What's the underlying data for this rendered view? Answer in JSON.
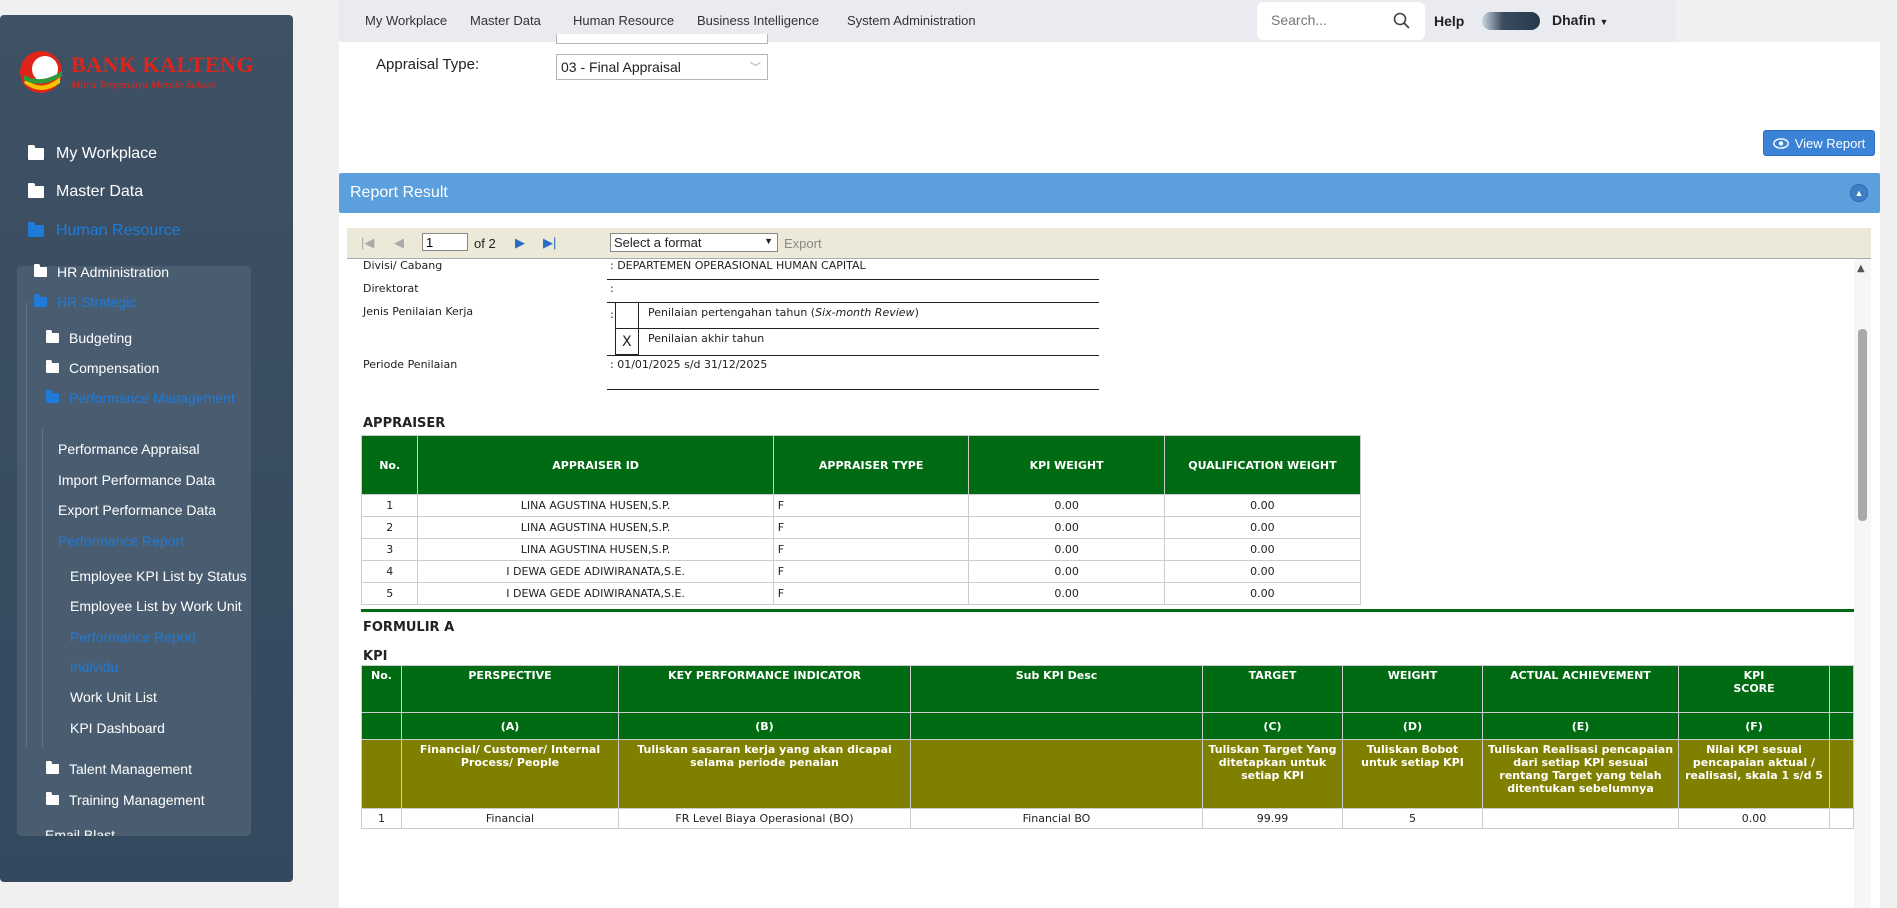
{
  "logo": {
    "title": "BANK KALTENG",
    "subtitle": "Mitra Terpercaya Meraih Sukses"
  },
  "sidebar": {
    "top": [
      {
        "label": "My Workplace"
      },
      {
        "label": "Master Data"
      },
      {
        "label": "Human Resource"
      }
    ],
    "hr": [
      {
        "label": "HR Administration"
      },
      {
        "label": "HR Strategic"
      },
      {
        "label": "Budgeting"
      },
      {
        "label": "Compensation"
      },
      {
        "label": "Performance Management"
      },
      {
        "label": "Performance Appraisal"
      },
      {
        "label": "Import Performance Data"
      },
      {
        "label": "Export Performance Data"
      },
      {
        "label": "Performance Report"
      },
      {
        "label": "Employee KPI List by Status"
      },
      {
        "label": "Employee List by Work Unit"
      },
      {
        "label": "Performance Report"
      },
      {
        "label": "Individu"
      },
      {
        "label": "Work Unit List"
      },
      {
        "label": "KPI Dashboard"
      },
      {
        "label": "Talent Management"
      },
      {
        "label": "Training Management"
      },
      {
        "label": "Email Blast"
      }
    ]
  },
  "topnav": {
    "menus": [
      "My Workplace",
      "Master Data",
      "Human Resource",
      "Business Intelligence",
      "System Administration"
    ],
    "search_placeholder": "Search...",
    "help": "Help",
    "user": "Dhafin"
  },
  "form": {
    "appraisal_type_label": "Appraisal Type:",
    "appraisal_type_value": "03 - Final Appraisal",
    "view_report": "View Report"
  },
  "result": {
    "title": "Report Result",
    "page": "1",
    "of_pages": "of 2",
    "format_placeholder": "Select a format",
    "export": "Export"
  },
  "report": {
    "info": [
      {
        "label": "Divisi/ Cabang",
        "value": ":  DEPARTEMEN OPERASIONAL HUMAN CAPITAL"
      },
      {
        "label": "Direktorat",
        "value": ":"
      },
      {
        "label": "Jenis Penilaian Kerja",
        "value": ":"
      },
      {
        "label": "Periode Penilaian",
        "value": ": 01/01/2025 s/d 31/12/2025"
      }
    ],
    "review_options": [
      {
        "mark": "",
        "text": "Penilaian pertengahan tahun (",
        "italic": "Six-month Review",
        "close": ")"
      },
      {
        "mark": "X",
        "text": "Penilaian akhir tahun"
      }
    ],
    "appraiser_title": "APPRAISER",
    "appraiser_headers": [
      "No.",
      "APPRAISER ID",
      "APPRAISER TYPE",
      "KPI WEIGHT",
      "QUALIFICATION WEIGHT"
    ],
    "appraisers": [
      [
        "1",
        "LINA AGUSTINA HUSEN,S.P.",
        "F",
        "0.00",
        "0.00"
      ],
      [
        "2",
        "LINA AGUSTINA HUSEN,S.P.",
        "F",
        "0.00",
        "0.00"
      ],
      [
        "3",
        "LINA AGUSTINA HUSEN,S.P.",
        "F",
        "0.00",
        "0.00"
      ],
      [
        "4",
        "I DEWA GEDE ADIWIRANATA,S.E.",
        "F",
        "0.00",
        "0.00"
      ],
      [
        "5",
        "I DEWA GEDE ADIWIRANATA,S.E.",
        "F",
        "0.00",
        "0.00"
      ]
    ],
    "formulir_title": "FORMULIR A",
    "kpi_title": "KPI",
    "kpi_headers": [
      "No.",
      "PERSPECTIVE",
      "KEY PERFORMANCE INDICATOR",
      "Sub KPI  Desc",
      "TARGET",
      "WEIGHT",
      "ACTUAL ACHIEVEMENT",
      "KPI\nSCORE",
      ""
    ],
    "kpi_letters": [
      "",
      "(A)",
      "(B)",
      "",
      "(C)",
      "(D)",
      "(E)",
      "(F)",
      ""
    ],
    "kpi_desc": [
      "",
      "Financial/ Customer/ Internal Process/ People",
      "Tuliskan sasaran kerja yang akan dicapai selama periode penaian",
      "",
      "Tuliskan  Target Yang ditetapkan untuk setiap KPI",
      "Tuliskan Bobot  untuk setiap KPI",
      "Tuliskan Realisasi pencapaian dari setiap KPI sesuai rentang Target yang telah ditentukan sebelumnya",
      "Nilai KPI  sesuai pencapaian  aktual / realisasi, skala 1 s/d 5",
      ""
    ],
    "kpi_partial": [
      "1",
      "Financial",
      "FR Level Biaya Operasional (BO)",
      "Financial BO",
      "99.99",
      "5",
      "",
      "0.00",
      ""
    ]
  }
}
